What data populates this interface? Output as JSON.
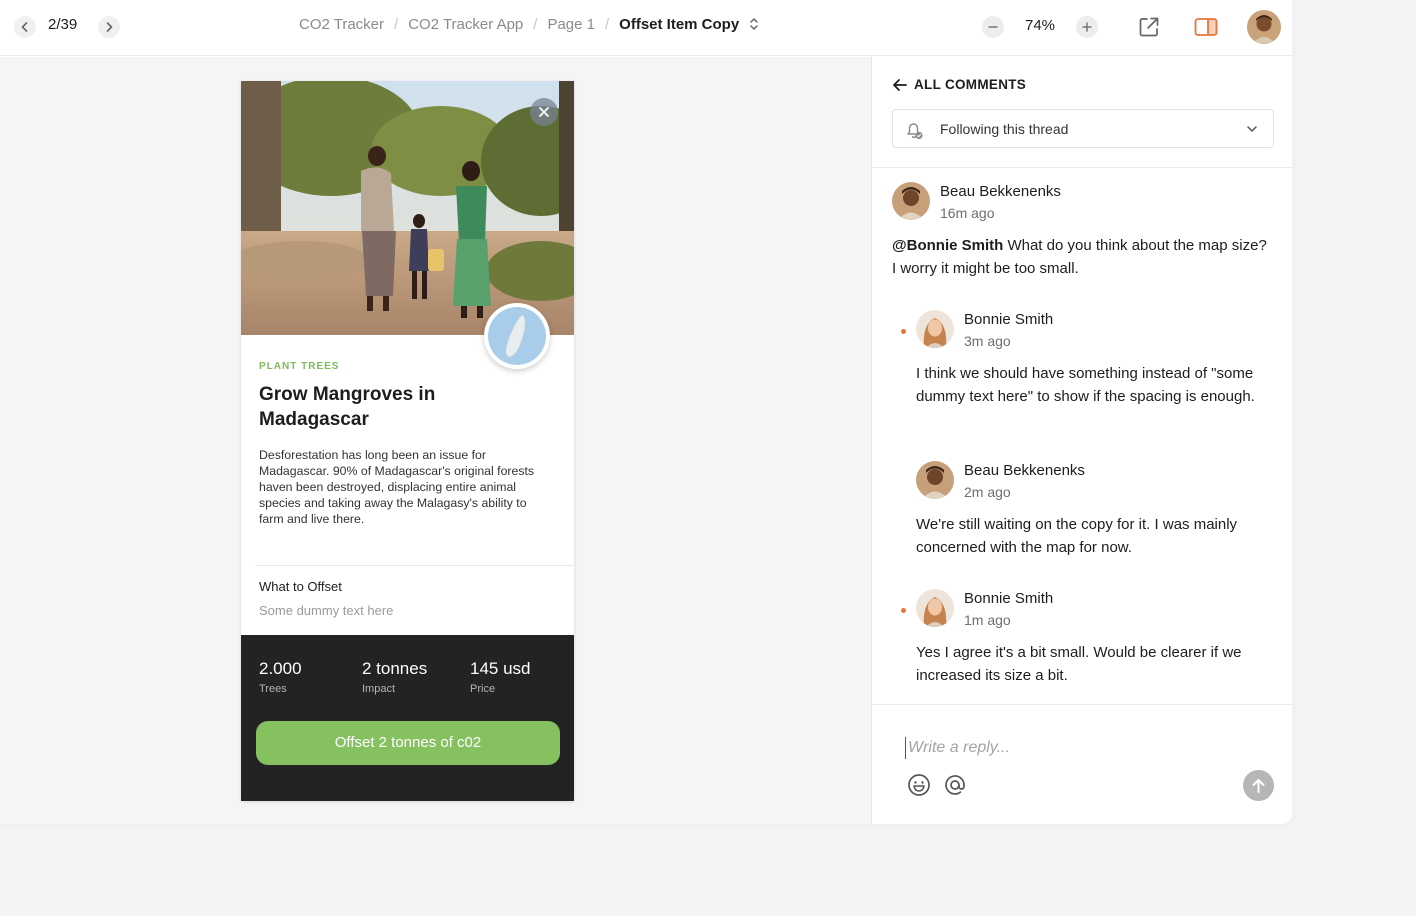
{
  "topbar": {
    "counter": "2/39",
    "breadcrumb": [
      "CO2 Tracker",
      "CO2 Tracker App",
      "Page 1"
    ],
    "current_page": "Offset Item Copy",
    "zoom": "74%"
  },
  "card": {
    "category": "PLANT TREES",
    "title": "Grow Mangroves in Madagascar",
    "description": "Desforestation has long been an issue for Madagascar. 90% of Madagascar's original forests haven been destroyed, displacing entire animal species and taking away the Malagasy's ability to farm and live there.",
    "what_to_offset_label": "What to Offset",
    "what_to_offset_value": "Some dummy text here",
    "stats": [
      {
        "value": "2.000",
        "label": "Trees"
      },
      {
        "value": "2 tonnes",
        "label": "Impact"
      },
      {
        "value": "145 usd",
        "label": "Price"
      }
    ],
    "cta": "Offset 2 tonnes of c02"
  },
  "panel": {
    "back_label": "ALL COMMENTS",
    "follow_label": "Following this thread",
    "comments": [
      {
        "author": "Beau Bekkenenks",
        "time": "16m ago",
        "mention": "@Bonnie Smith",
        "body": " What do you think about the map size? I worry it might be too small."
      },
      {
        "author": "Bonnie Smith",
        "time": "3m ago",
        "body": "I think we should have something instead of \"some dummy text here\" to show if the spacing is enough."
      },
      {
        "author": "Beau Bekkenenks",
        "time": "2m ago",
        "body": "We're still waiting on the copy for it. I was mainly concerned with the map for now."
      },
      {
        "author": "Bonnie Smith",
        "time": "1m ago",
        "body": "Yes I agree it's a bit small. Would be clearer if we increased its size a bit."
      }
    ],
    "reply_placeholder": "Write a reply..."
  },
  "colors": {
    "accent_green": "#86c160",
    "category_green": "#7cba5a",
    "unread_dot": "#e8763a",
    "dark_footer": "#232323",
    "panel_toggle": "#e8763a"
  },
  "icons": [
    "chevron-left-icon",
    "chevron-right-icon",
    "minus-icon",
    "plus-icon",
    "external-link-icon",
    "sidebar-toggle-icon",
    "close-icon",
    "arrow-left-icon",
    "bell-icon",
    "chevron-down-icon",
    "emoji-icon",
    "at-icon",
    "arrow-up-icon"
  ]
}
